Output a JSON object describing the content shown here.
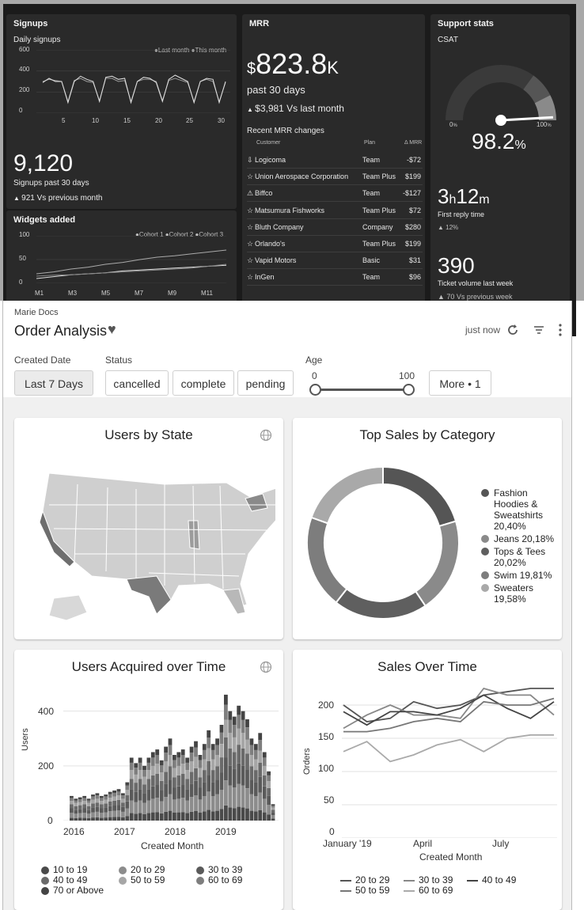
{
  "top": {
    "signups": {
      "title": "Signups",
      "subtitle": "Daily signups",
      "legend": [
        "Last month",
        "This month"
      ],
      "y_ticks": [
        "600",
        "400",
        "200",
        "0"
      ],
      "x_ticks": [
        "5",
        "10",
        "15",
        "20",
        "25",
        "30"
      ],
      "big_value": "9,120",
      "big_label": "Signups past 30 days",
      "delta": "921 Vs previous month"
    },
    "widgets": {
      "title": "Widgets added",
      "legend": [
        "Cohort 1",
        "Cohort 2",
        "Cohort 3"
      ],
      "y_ticks": [
        "100",
        "50",
        "0"
      ],
      "x_ticks": [
        "M1",
        "M3",
        "M5",
        "M7",
        "M9",
        "M11"
      ]
    },
    "mrr": {
      "title": "MRR",
      "dollar": "$",
      "value": "823.8",
      "suffix": "K",
      "period": "past 30 days",
      "delta": "$3,981 Vs last month",
      "changes_title": "Recent MRR changes",
      "col_customer": "Customer",
      "col_plan": "Plan",
      "col_delta": "Δ MRR",
      "rows": [
        {
          "icon": "⇩",
          "name": "Logicoma",
          "plan": "Team",
          "delta": "-$72"
        },
        {
          "icon": "☆",
          "name": "Union Aerospace Corporation",
          "plan": "Team Plus",
          "delta": "$199"
        },
        {
          "icon": "⚠",
          "name": "Biffco",
          "plan": "Team",
          "delta": "-$127"
        },
        {
          "icon": "☆",
          "name": "Matsumura Fishworks",
          "plan": "Team Plus",
          "delta": "$72"
        },
        {
          "icon": "☆",
          "name": "Bluth Company",
          "plan": "Company",
          "delta": "$280"
        },
        {
          "icon": "☆",
          "name": "Orlando's",
          "plan": "Team Plus",
          "delta": "$199"
        },
        {
          "icon": "☆",
          "name": "Vapid Motors",
          "plan": "Basic",
          "delta": "$31"
        },
        {
          "icon": "☆",
          "name": "InGen",
          "plan": "Team",
          "delta": "$96"
        }
      ]
    },
    "support": {
      "title": "Support stats",
      "csat_label": "CSAT",
      "gauge_min": "0",
      "gauge_max": "100",
      "pct_sign": "%",
      "csat_value": "98.2",
      "csat_level": 0.982,
      "reply_h": "3",
      "reply_h_unit": "h",
      "reply_m": "12",
      "reply_m_unit": "m",
      "reply_label": "First reply time",
      "reply_delta": "12",
      "ticket_value": "390",
      "ticket_label": "Ticket volume last week",
      "ticket_delta": "70 Vs previous week"
    }
  },
  "header": {
    "breadcrumb": "Marie Docs",
    "title": "Order Analysis",
    "refreshed": "just now"
  },
  "filters": {
    "created_label": "Created Date",
    "created_value": "Last 7 Days",
    "status_label": "Status",
    "status_options": [
      "cancelled",
      "complete",
      "pending"
    ],
    "age_label": "Age",
    "age_min": "0",
    "age_max": "100",
    "more": "More • 1"
  },
  "cards": {
    "users_by_state": {
      "title": "Users by State"
    },
    "top_sales": {
      "title": "Top Sales by Category",
      "legend": [
        {
          "label": "Fashion Hoodies & Sweatshirts 20,40%",
          "color": "#555555"
        },
        {
          "label": "Jeans 20,18%",
          "color": "#8a8a8a"
        },
        {
          "label": "Tops & Tees 20,02%",
          "color": "#5f5f5f"
        },
        {
          "label": "Swim 19,81%",
          "color": "#7d7d7d"
        },
        {
          "label": "Sweaters 19,58%",
          "color": "#a9a9a9"
        }
      ]
    },
    "users_acquired": {
      "title": "Users Acquired over Time",
      "ylabel": "Users",
      "xlabel": "Created Month",
      "y_ticks": [
        "400",
        "200",
        "0"
      ],
      "x_ticks": [
        "2016",
        "2017",
        "2018",
        "2019"
      ],
      "legend": [
        "10 to 19",
        "20 to 29",
        "30 to 39",
        "40 to 49",
        "50 to 59",
        "60 to 69",
        "70 or Above"
      ]
    },
    "sales_over_time": {
      "title": "Sales Over Time",
      "ylabel": "Orders",
      "xlabel": "Created Month",
      "y_ticks": [
        "200",
        "150",
        "100",
        "50",
        "0"
      ],
      "x_ticks": [
        "January '19",
        "April",
        "July"
      ],
      "legend": [
        "20 to 29",
        "30 to 39",
        "40 to 49",
        "50 to 59",
        "60 to 69"
      ]
    }
  },
  "chart_data": [
    {
      "type": "line",
      "title": "Sales Over Time",
      "xlabel": "Created Month",
      "ylabel": "Orders",
      "ylim": [
        0,
        200
      ],
      "x": [
        "2019-01",
        "2019-02",
        "2019-03",
        "2019-04",
        "2019-05",
        "2019-06",
        "2019-07",
        "2019-08",
        "2019-09",
        "2019-10"
      ],
      "series": [
        {
          "name": "20 to 29",
          "values": [
            200,
            175,
            180,
            205,
            195,
            200,
            215,
            220,
            225,
            225
          ]
        },
        {
          "name": "30 to 39",
          "values": [
            165,
            185,
            200,
            185,
            185,
            180,
            225,
            215,
            215,
            185
          ]
        },
        {
          "name": "40 to 49",
          "values": [
            190,
            170,
            190,
            190,
            185,
            195,
            215,
            195,
            180,
            205
          ]
        },
        {
          "name": "50 to 59",
          "values": [
            160,
            160,
            165,
            175,
            180,
            175,
            205,
            200,
            200,
            210
          ]
        },
        {
          "name": "60 to 69",
          "values": [
            130,
            145,
            115,
            125,
            140,
            148,
            130,
            150,
            155,
            155
          ]
        }
      ]
    },
    {
      "type": "bar",
      "title": "Users Acquired over Time",
      "xlabel": "Created Month",
      "ylabel": "Users",
      "ylim": [
        0,
        480
      ],
      "x_range": [
        "2016",
        "2019"
      ],
      "totals": [
        90,
        80,
        85,
        90,
        80,
        95,
        100,
        90,
        95,
        105,
        110,
        115,
        100,
        140,
        230,
        210,
        230,
        200,
        230,
        250,
        260,
        220,
        270,
        300,
        240,
        250,
        260,
        230,
        270,
        290,
        240,
        280,
        330,
        280,
        300,
        350,
        460,
        400,
        380,
        420,
        400,
        370,
        300,
        280,
        320,
        250,
        180,
        60
      ]
    },
    {
      "type": "pie",
      "title": "Top Sales by Category",
      "categories": [
        "Fashion Hoodies & Sweatshirts",
        "Jeans",
        "Tops & Tees",
        "Swim",
        "Sweaters"
      ],
      "values": [
        20.4,
        20.18,
        20.02,
        19.81,
        19.58
      ]
    },
    {
      "type": "line",
      "title": "Daily signups",
      "xlabel": "",
      "ylabel": "",
      "ylim": [
        0,
        600
      ],
      "x": [
        1,
        2,
        3,
        4,
        5,
        6,
        7,
        8,
        9,
        10,
        11,
        12,
        13,
        14,
        15,
        16,
        17,
        18,
        19,
        20,
        21,
        22,
        23,
        24,
        25,
        26,
        27,
        28,
        29,
        30
      ],
      "series": [
        {
          "name": "Last month",
          "values": [
            300,
            320,
            310,
            300,
            110,
            310,
            330,
            300,
            290,
            120,
            330,
            330,
            300,
            310,
            110,
            300,
            320,
            320,
            300,
            120,
            310,
            330,
            310,
            290,
            110,
            300,
            320,
            300,
            110,
            290
          ]
        },
        {
          "name": "This month",
          "values": [
            290,
            330,
            300,
            300,
            100,
            300,
            350,
            320,
            300,
            110,
            340,
            350,
            320,
            330,
            100,
            300,
            340,
            330,
            290,
            110,
            320,
            360,
            330,
            300,
            100,
            300,
            330,
            320,
            100,
            300
          ]
        }
      ]
    },
    {
      "type": "line",
      "title": "Widgets added",
      "ylim": [
        0,
        100
      ],
      "x": [
        "M1",
        "M2",
        "M3",
        "M4",
        "M5",
        "M6",
        "M7",
        "M8",
        "M9",
        "M10",
        "M11",
        "M12"
      ],
      "series": [
        {
          "name": "Cohort 1",
          "values": [
            20,
            24,
            30,
            34,
            40,
            44,
            50,
            55,
            58,
            62,
            66,
            70
          ]
        },
        {
          "name": "Cohort 2",
          "values": [
            10,
            14,
            18,
            20,
            22,
            26,
            28,
            30,
            32,
            34,
            36,
            38
          ]
        },
        {
          "name": "Cohort 3",
          "values": [
            15,
            17,
            18,
            20,
            22,
            24,
            26,
            28,
            30,
            32,
            36,
            40
          ]
        }
      ]
    }
  ]
}
